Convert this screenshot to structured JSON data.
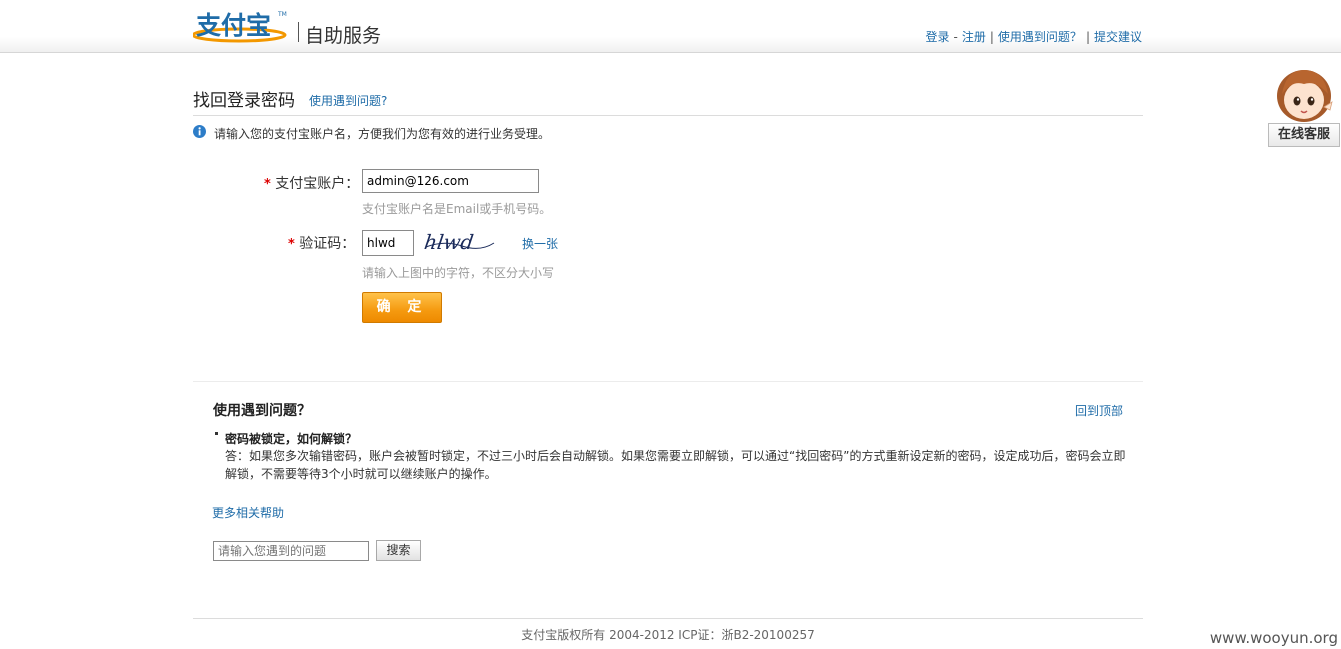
{
  "header": {
    "logo_text": "支付宝",
    "title": "自助服务",
    "links": {
      "login": "登录",
      "register": "注册",
      "problem": "使用遇到问题？",
      "feedback": "提交建议"
    }
  },
  "service_widget": {
    "label": "在线客服"
  },
  "page": {
    "title": "找回登录密码",
    "title_help": "使用遇到问题?",
    "info": "请输入您的支付宝账户名，方便我们为您有效的进行业务受理。"
  },
  "form": {
    "required_mark": "*",
    "account": {
      "label": "支付宝账户：",
      "value": "admin@126.com",
      "hint": "支付宝账户名是Email或手机号码。"
    },
    "captcha": {
      "label": "验证码：",
      "value": "hlwd",
      "image_text": "hlwd",
      "refresh": "换一张",
      "hint": "请输入上图中的字符，不区分大小写"
    },
    "submit": "确 定"
  },
  "help": {
    "title": "使用遇到问题？",
    "back_to_top": "回到顶部",
    "question": "密码被锁定，如何解锁？",
    "answer": "答：如果您多次输错密码，账户会被暂时锁定，不过三小时后会自动解锁。如果您需要立即解锁，可以通过“找回密码”的方式重新设定新的密码，设定成功后，密码会立即解锁，不需要等待3个小时就可以继续账户的操作。",
    "more": "更多相关帮助",
    "search_placeholder": "请输入您遇到的问题",
    "search_button": "搜索"
  },
  "footer": {
    "copyright": "支付宝版权所有 2004-2012 ICP证：浙B2-20100257"
  },
  "watermark": "www.wooyun.org",
  "colors": {
    "link": "#1f6ca8",
    "brand_orange": "#f39800",
    "required": "#dd0000",
    "hint": "#9a9a9a"
  }
}
